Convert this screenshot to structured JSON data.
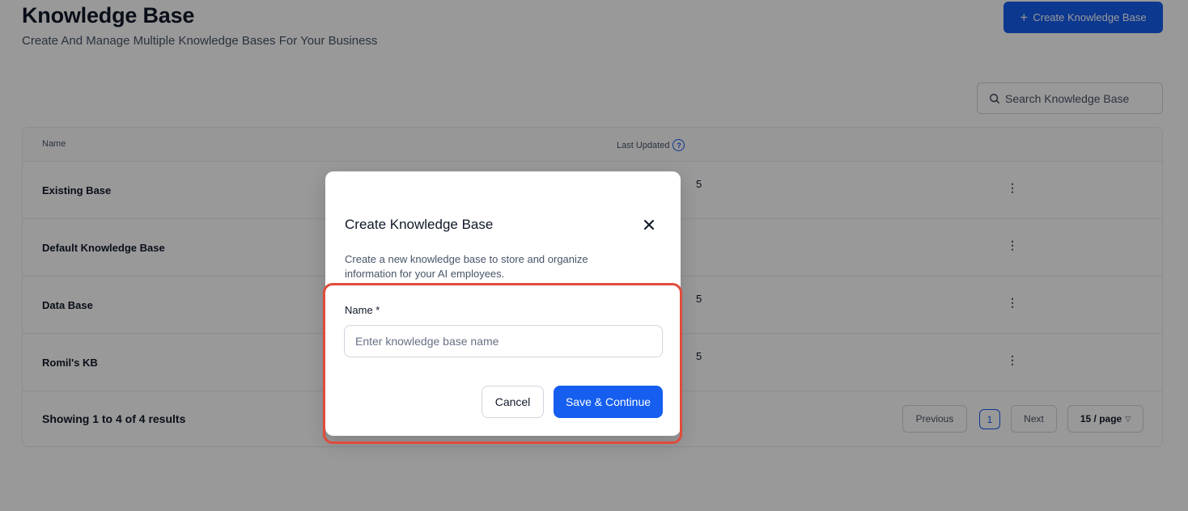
{
  "header": {
    "title": "Knowledge Base",
    "subtitle": "Create And Manage Multiple Knowledge Bases For Your Business",
    "create_button_icon": "plus-icon",
    "create_button_label": "Create Knowledge Base"
  },
  "search": {
    "icon": "search-icon",
    "placeholder": "Search Knowledge Base"
  },
  "table": {
    "columns": {
      "name": "Name",
      "last_updated": "Last Updated"
    },
    "rows": [
      {
        "name": "Existing Base",
        "updated": "5"
      },
      {
        "name": "Default Knowledge Base",
        "updated": ""
      },
      {
        "name": "Data Base",
        "updated": "5"
      },
      {
        "name": "Romil's KB",
        "updated": "5"
      }
    ],
    "row_menu_icon": "more-vertical-icon",
    "footer": {
      "summary": "Showing 1 to 4 of 4 results",
      "previous": "Previous",
      "current_page": "1",
      "next": "Next",
      "per_page": "15 / page"
    }
  },
  "modal": {
    "title": "Create Knowledge Base",
    "close_icon": "close-icon",
    "description": "Create a new knowledge base to store and organize information for your AI employees.",
    "field_label": "Name *",
    "input_value": "",
    "input_placeholder": "Enter knowledge base name",
    "cancel_label": "Cancel",
    "save_label": "Save & Continue"
  },
  "colors": {
    "primary": "#155eef",
    "highlight": "#e14b3b",
    "overlay": "rgba(0,0,0,0.40)"
  }
}
